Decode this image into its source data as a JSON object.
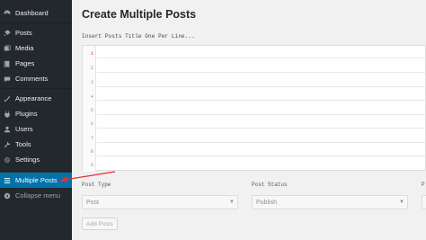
{
  "sidebar": {
    "items": [
      {
        "label": "Dashboard",
        "icon": "dashboard-icon"
      },
      {
        "label": "Posts",
        "icon": "pin-icon"
      },
      {
        "label": "Media",
        "icon": "media-icon"
      },
      {
        "label": "Pages",
        "icon": "pages-icon"
      },
      {
        "label": "Comments",
        "icon": "comments-icon"
      },
      {
        "label": "Appearance",
        "icon": "appearance-icon"
      },
      {
        "label": "Plugins",
        "icon": "plugins-icon"
      },
      {
        "label": "Users",
        "icon": "users-icon"
      },
      {
        "label": "Tools",
        "icon": "tools-icon"
      },
      {
        "label": "Settings",
        "icon": "settings-icon"
      },
      {
        "label": "Multiple Posts",
        "icon": "list-icon",
        "active": true
      },
      {
        "label": "Collapse menu",
        "icon": "collapse-icon"
      }
    ]
  },
  "main": {
    "title": "Create Multiple Posts",
    "instructions": "Insert Posts Title One Per Line...",
    "editor": {
      "line_numbers": [
        "1",
        "2",
        "3",
        "4",
        "5",
        "6",
        "7",
        "8",
        "9"
      ]
    },
    "post_type": {
      "label": "Post Type",
      "value": "Post"
    },
    "post_status": {
      "label": "Post Status",
      "value": "Publish"
    },
    "third_field": {
      "label": "P"
    },
    "add_button": "Add Posts"
  },
  "colors": {
    "sidebar_bg": "#23282d",
    "active_bg": "#0073aa",
    "arrow": "#e2312d"
  }
}
